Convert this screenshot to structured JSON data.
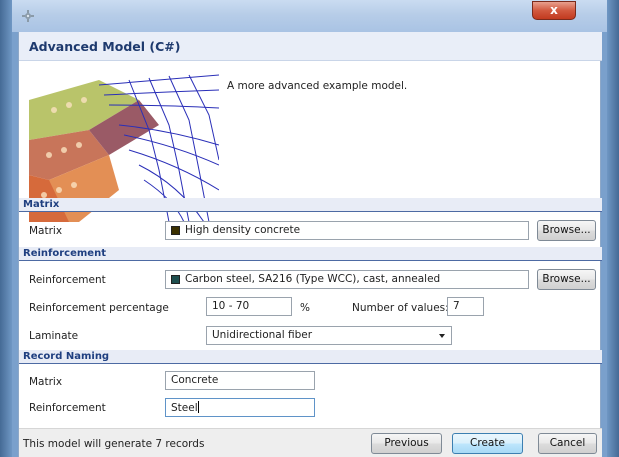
{
  "window": {
    "close_label": "x"
  },
  "header": {
    "title": "Advanced Model (C#)"
  },
  "preview": {
    "description": "A more advanced example model."
  },
  "sections": {
    "matrix": "Matrix",
    "reinforcement": "Reinforcement",
    "record_naming": "Record Naming"
  },
  "matrix": {
    "label": "Matrix",
    "value": "High density concrete",
    "swatch_color": "#3b3000",
    "browse_label": "Browse..."
  },
  "reinforcement": {
    "label": "Reinforcement",
    "value": "Carbon steel, SA216 (Type WCC), cast, annealed",
    "swatch_color": "#1f4f4f",
    "browse_label": "Browse...",
    "percentage_label": "Reinforcement percentage",
    "percentage_value": "10 - 70",
    "percent_unit": "%",
    "num_values_label": "Number of values:",
    "num_values_value": "7",
    "laminate_label": "Laminate",
    "laminate_value": "Unidirectional fiber"
  },
  "record_naming": {
    "matrix_label": "Matrix",
    "matrix_value": "Concrete",
    "reinforcement_label": "Reinforcement",
    "reinforcement_value": "Steel"
  },
  "footer": {
    "status": "This model will generate 7 records",
    "previous_label": "Previous",
    "create_label": "Create",
    "cancel_label": "Cancel"
  },
  "colors": {
    "accent": "#1f3f80",
    "header_bg": "#e9eef8"
  }
}
